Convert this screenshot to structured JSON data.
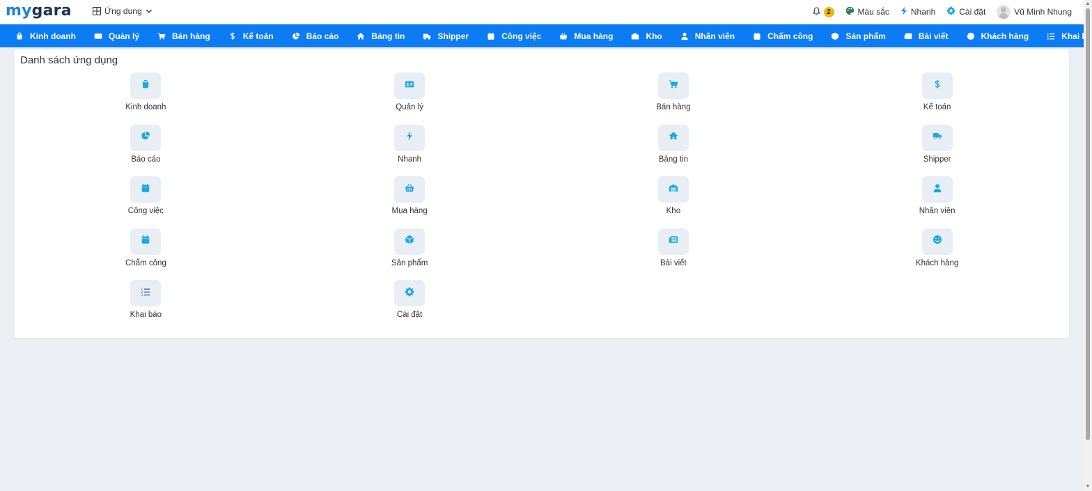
{
  "brand": {
    "part1": "my",
    "part2": "gara"
  },
  "apps_switch": {
    "label": "Ứng dụng"
  },
  "top_right": {
    "notifications_count": "2",
    "color_label": "Màu sắc",
    "quick_label": "Nhanh",
    "settings_label": "Cài đặt",
    "user_name": "Vũ Minh Nhung"
  },
  "nav": [
    {
      "label": "Kinh doanh",
      "icon": "shopping-bag-icon"
    },
    {
      "label": "Quản lý",
      "icon": "id-card-icon"
    },
    {
      "label": "Bán hàng",
      "icon": "cart-icon"
    },
    {
      "label": "Kế toán",
      "icon": "dollar-icon"
    },
    {
      "label": "Báo cáo",
      "icon": "pie-chart-icon"
    },
    {
      "label": "Bảng tin",
      "icon": "home-icon"
    },
    {
      "label": "Shipper",
      "icon": "truck-icon"
    },
    {
      "label": "Công việc",
      "icon": "calendar-icon"
    },
    {
      "label": "Mua hàng",
      "icon": "basket-icon"
    },
    {
      "label": "Kho",
      "icon": "warehouse-icon"
    },
    {
      "label": "Nhân viên",
      "icon": "user-icon"
    },
    {
      "label": "Chấm công",
      "icon": "calendar-icon"
    },
    {
      "label": "Sản phẩm",
      "icon": "box-icon"
    },
    {
      "label": "Bài viết",
      "icon": "newspaper-icon"
    },
    {
      "label": "Khách hàng",
      "icon": "smile-icon"
    },
    {
      "label": "Khai báo",
      "icon": "list-ol-icon"
    }
  ],
  "app_list": {
    "title": "Danh sách ứng dụng",
    "apps": [
      {
        "label": "Kinh doanh",
        "icon": "shopping-bag-icon"
      },
      {
        "label": "Quản lý",
        "icon": "id-card-icon"
      },
      {
        "label": "Bán hàng",
        "icon": "cart-icon"
      },
      {
        "label": "Kế toán",
        "icon": "dollar-icon"
      },
      {
        "label": "Báo cáo",
        "icon": "pie-chart-icon"
      },
      {
        "label": "Nhanh",
        "icon": "bolt-icon"
      },
      {
        "label": "Bảng tin",
        "icon": "home-icon"
      },
      {
        "label": "Shipper",
        "icon": "truck-icon"
      },
      {
        "label": "Công việc",
        "icon": "calendar-icon"
      },
      {
        "label": "Mua hàng",
        "icon": "basket-icon"
      },
      {
        "label": "Kho",
        "icon": "warehouse-icon"
      },
      {
        "label": "Nhân viên",
        "icon": "user-icon"
      },
      {
        "label": "Chấm công",
        "icon": "calendar-icon"
      },
      {
        "label": "Sản phẩm",
        "icon": "box-icon"
      },
      {
        "label": "Bài viết",
        "icon": "newspaper-icon"
      },
      {
        "label": "Khách hàng",
        "icon": "smile-icon"
      },
      {
        "label": "Khai báo",
        "icon": "list-ol-icon"
      },
      {
        "label": "Cài đặt",
        "icon": "gear-icon"
      }
    ]
  },
  "colors": {
    "nav_bg": "#0b7cf4",
    "app_icon_color": "#17a9e1",
    "app_icon_alt_color": "#4a5ea8",
    "badge": "#f5b800"
  }
}
